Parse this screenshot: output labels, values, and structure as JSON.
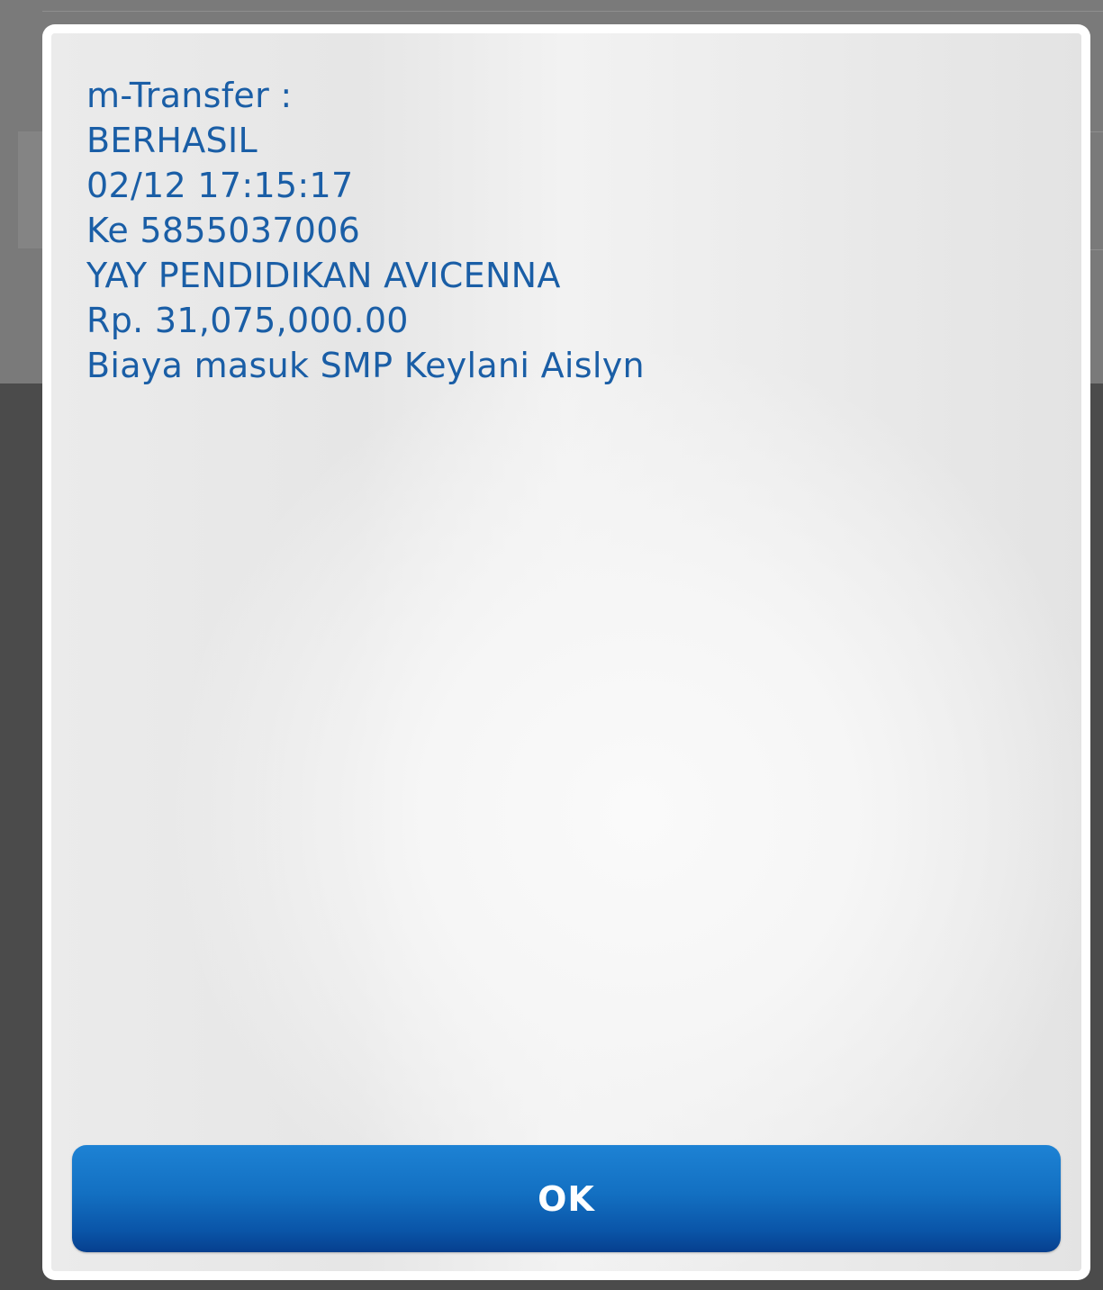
{
  "dialog": {
    "lines": [
      "m-Transfer :",
      "BERHASIL",
      "02/12 17:15:17",
      "Ke 5855037006",
      "YAY PENDIDIKAN AVICENNA",
      "Rp. 31,075,000.00",
      "Biaya masuk SMP Keylani Aislyn"
    ],
    "ok_label": "OK"
  },
  "colors": {
    "message_text": "#1a5ea6",
    "button_blue": "#1370c2",
    "button_text": "#ffffff"
  }
}
